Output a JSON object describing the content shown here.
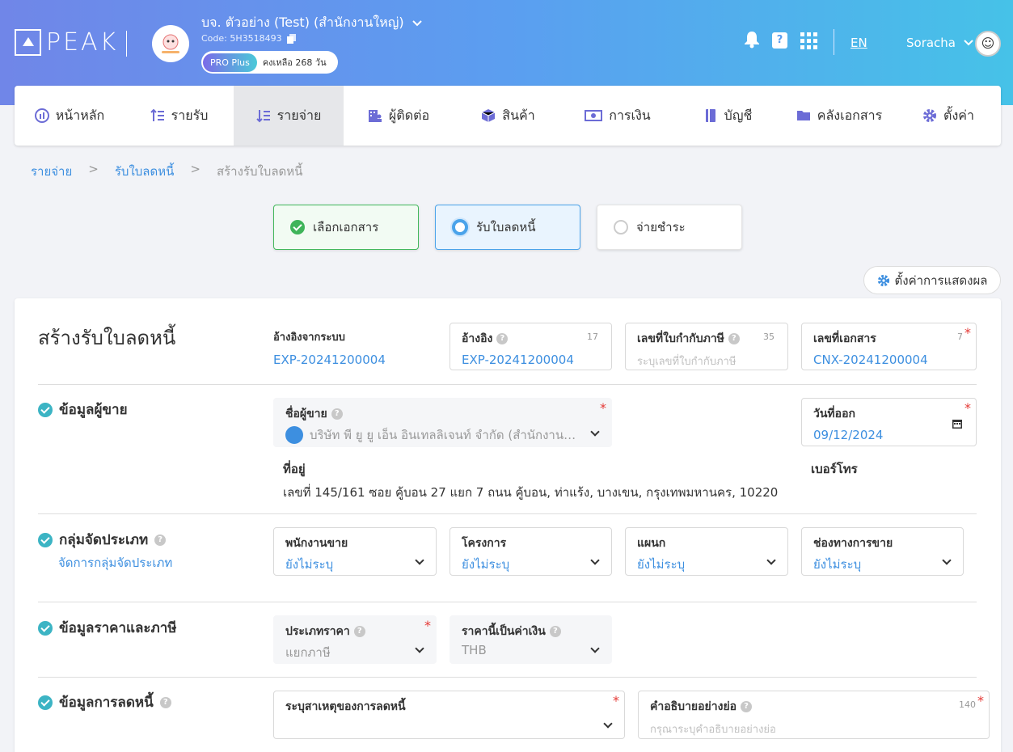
{
  "header": {
    "logo_text": "PEAK",
    "company_name": "บจ. ตัวอย่าง (Test) (สำนักงานใหญ่)",
    "company_code": "Code: 5H3518493",
    "plan_badge": "PRO Plus",
    "plan_days": "คงเหลือ 268 วัน",
    "language": "EN",
    "user_name": "Soracha",
    "accent_gradient": [
      "#7086e8",
      "#46c2e8"
    ]
  },
  "nav": [
    {
      "label": "หน้าหลัก",
      "icon": "dashboard-icon"
    },
    {
      "label": "รายรับ",
      "icon": "income-icon"
    },
    {
      "label": "รายจ่าย",
      "icon": "expense-icon",
      "active": true
    },
    {
      "label": "ผู้ติดต่อ",
      "icon": "contacts-icon"
    },
    {
      "label": "สินค้า",
      "icon": "product-box-icon"
    },
    {
      "label": "การเงิน",
      "icon": "money-icon"
    },
    {
      "label": "บัญชี",
      "icon": "book-icon"
    },
    {
      "label": "คลังเอกสาร",
      "icon": "folder-icon"
    },
    {
      "label": "ตั้งค่า",
      "icon": "gear-icon"
    }
  ],
  "breadcrumb": {
    "level1": "รายจ่าย",
    "level2": "รับใบลดหนี้",
    "level3": "สร้างรับใบลดหนี้",
    "sep": ">"
  },
  "steps": [
    {
      "label": "เลือกเอกสาร",
      "state": "done"
    },
    {
      "label": "รับใบลดหนี้",
      "state": "active"
    },
    {
      "label": "จ่ายชำระ",
      "state": "pending"
    }
  ],
  "display_settings_label": "ตั้งค่าการแสดงผล",
  "form": {
    "title": "สร้างรับใบลดหนี้",
    "system_ref_label": "อ้างอิงจากระบบ",
    "system_ref_value": "EXP-20241200004",
    "reference": {
      "label": "อ้างอิง",
      "count": "17",
      "value": "EXP-20241200004"
    },
    "tax_invoice": {
      "label": "เลขที่ใบกำกับภาษี",
      "count": "35",
      "placeholder": "ระบุเลขที่ใบกำกับภาษี"
    },
    "doc_number": {
      "label": "เลขที่เอกสาร",
      "count": "7",
      "value": "CNX-20241200004"
    },
    "req_mark": "*",
    "vendor_section": {
      "title": "ข้อมูลผู้ขาย",
      "vendor_label": "ชื่อผู้ขาย",
      "vendor_value": "บริษัท พี ยู ยู เอ็น อินเทลลิเจนท์ จำกัด (สำนักงานให...",
      "issue_date_label": "วันที่ออก",
      "issue_date_value": "09/12/2024",
      "address_label": "ที่อยู่",
      "address_value": "เลขที่ 145/161 ซอย คู้บอน 27 แยก 7 ถนน คู้บอน, ท่าแร้ง, บางเขน, กรุงเทพมหานคร, 10220",
      "phone_label": "เบอร์โทร"
    },
    "group_section": {
      "title": "กลุ่มจัดประเภท",
      "manage_link": "จัดการกลุ่มจัดประเภท",
      "fields": [
        {
          "label": "พนักงานขาย",
          "value": "ยังไม่ระบุ"
        },
        {
          "label": "โครงการ",
          "value": "ยังไม่ระบุ"
        },
        {
          "label": "แผนก",
          "value": "ยังไม่ระบุ"
        },
        {
          "label": "ช่องทางการขาย",
          "value": "ยังไม่ระบุ"
        }
      ]
    },
    "price_section": {
      "title": "ข้อมูลราคาและภาษี",
      "price_type_label": "ประเภทราคา",
      "price_type_value": "แยกภาษี",
      "currency_label": "ราคานี้เป็นค่าเงิน",
      "currency_value": "THB"
    },
    "credit_section": {
      "title": "ข้อมูลการลดหนี้",
      "reason_label": "ระบุสาเหตุของการลดหนี้",
      "desc_label": "คำอธิบายอย่างย่อ",
      "desc_count": "140",
      "desc_placeholder": "กรุณาระบุคำอธิบายอย่างย่อ"
    }
  }
}
